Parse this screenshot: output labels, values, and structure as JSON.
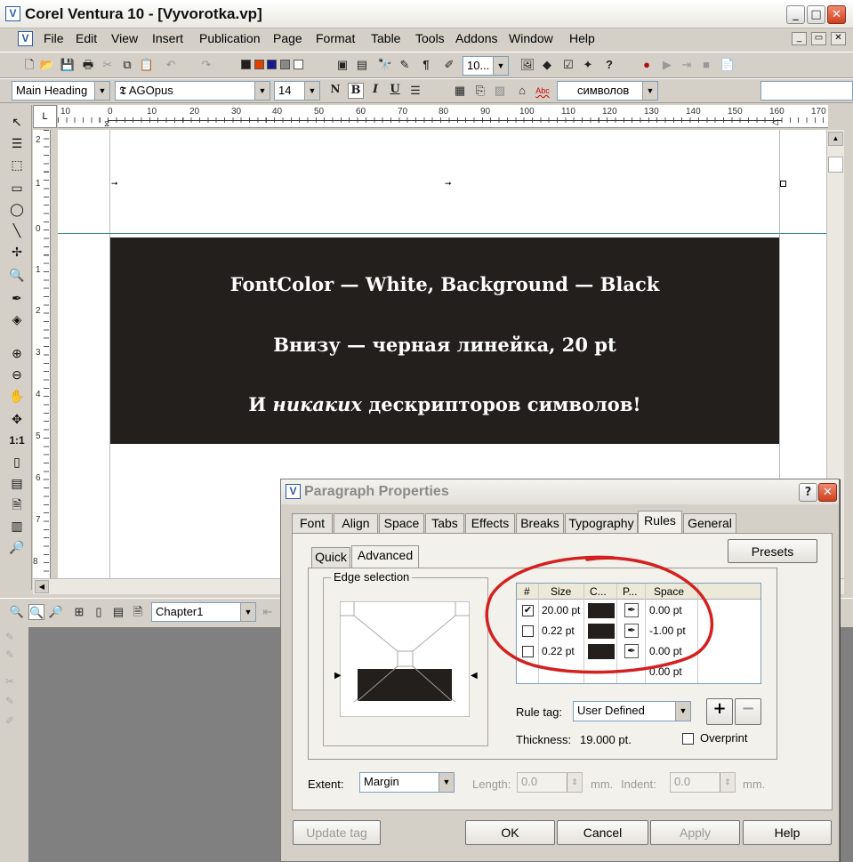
{
  "window": {
    "title": "Corel Ventura 10 - [Vyvorotka.vp]",
    "app_icon_letter": "V",
    "controls": {
      "minimize": "_",
      "maximize": "□",
      "close": "✕"
    }
  },
  "menu": [
    "File",
    "Edit",
    "View",
    "Insert",
    "Publication",
    "Page",
    "Format",
    "Table",
    "Tools",
    "Addons",
    "Window",
    "Help"
  ],
  "doc_controls": {
    "minimize": "_",
    "restore": "▭",
    "close": "✕"
  },
  "toolbar": {
    "zoom_value": "10..."
  },
  "format_bar": {
    "tag": "Main Heading",
    "font": "AGOpus",
    "size": "14",
    "bold": "B",
    "italic": "I",
    "underline": "U",
    "n_label": "N",
    "spell_label": "Abc",
    "lang_value": "символов"
  },
  "hruler_ticks": [
    "10",
    "0",
    "10",
    "20",
    "30",
    "40",
    "50",
    "60",
    "70",
    "80",
    "90",
    "100",
    "110",
    "120",
    "130",
    "140",
    "150",
    "160",
    "170"
  ],
  "vruler_ticks": [
    "2",
    "1",
    "0",
    "1",
    "2",
    "3",
    "4",
    "5",
    "6",
    "7",
    "8",
    "9",
    "10"
  ],
  "document": {
    "line1": "FontColor — White, Background  — Black",
    "line2": "Внизу — черная линейка, 20 pt",
    "line3_pre": "И ",
    "line3_italic": "никаких",
    "line3_post": " дескрипторов символов!"
  },
  "statusbar": {
    "chapter": "Chapter1"
  },
  "dialog": {
    "title": "Paragraph Properties",
    "help_btn": "?",
    "close_btn": "✕",
    "tabs": [
      "Font",
      "Align",
      "Space",
      "Tabs",
      "Effects",
      "Breaks",
      "Typography",
      "Rules",
      "General"
    ],
    "active_tab": "Rules",
    "subtabs": [
      "Quick",
      "Advanced"
    ],
    "presets": "Presets",
    "edge_selection": "Edge selection",
    "grid_headers": [
      "#",
      "Size",
      "C...",
      "P...",
      "Space"
    ],
    "rows": [
      {
        "checked": true,
        "size": "20.00 pt",
        "space": "0.00 pt"
      },
      {
        "checked": false,
        "size": "0.22 pt",
        "space": "-1.00 pt"
      },
      {
        "checked": false,
        "size": "0.22 pt",
        "space": "0.00 pt"
      },
      {
        "checked": null,
        "size": "",
        "space": "0.00 pt"
      }
    ],
    "rule_tag_label": "Rule tag:",
    "rule_tag_value": "User Defined",
    "add": "+",
    "remove": "−",
    "thickness_label": "Thickness:",
    "thickness_value": "19.000 pt.",
    "overprint": "Overprint",
    "extent_label": "Extent:",
    "extent_value": "Margin",
    "length_label": "Length:",
    "length_value": "0.0",
    "length_unit": "mm.",
    "indent_label": "Indent:",
    "indent_value": "0.0",
    "indent_unit": "mm.",
    "buttons": {
      "update_tag": "Update tag",
      "ok": "OK",
      "cancel": "Cancel",
      "apply": "Apply",
      "help": "Help"
    }
  },
  "colors": {
    "banner": "#231f1c",
    "annotation": "#d42020",
    "title_text": "#111111"
  }
}
